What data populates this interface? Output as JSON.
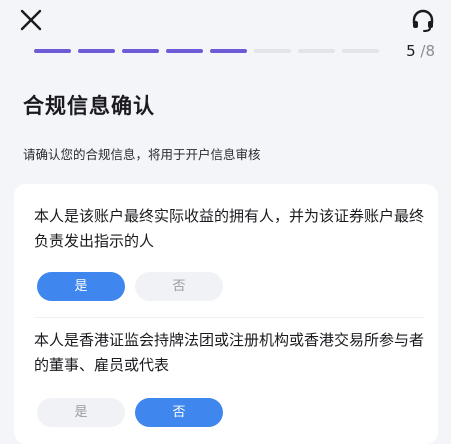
{
  "header": {
    "close_icon": "close-icon",
    "support_icon": "headset-icon",
    "step_current": "5",
    "step_total": "/8",
    "progress_total_steps": 8,
    "progress_completed_steps": 5
  },
  "colors": {
    "accent": "#6c5bd6",
    "button_selected": "#3f86ee",
    "background": "#f4f5f8"
  },
  "page": {
    "title": "合规信息确认",
    "subtitle": "请确认您的合规信息，将用于开户信息审核"
  },
  "questions": [
    {
      "text": "本人是该账户最终实际收益的拥有人，并为该证券账户最终负责发出指示的人",
      "yes_label": "是",
      "no_label": "否",
      "selected": "yes"
    },
    {
      "text": "本人是香港证监会持牌法团或注册机构或香港交易所参与者的董事、雇员或代表",
      "yes_label": "是",
      "no_label": "否",
      "selected": "no"
    }
  ]
}
